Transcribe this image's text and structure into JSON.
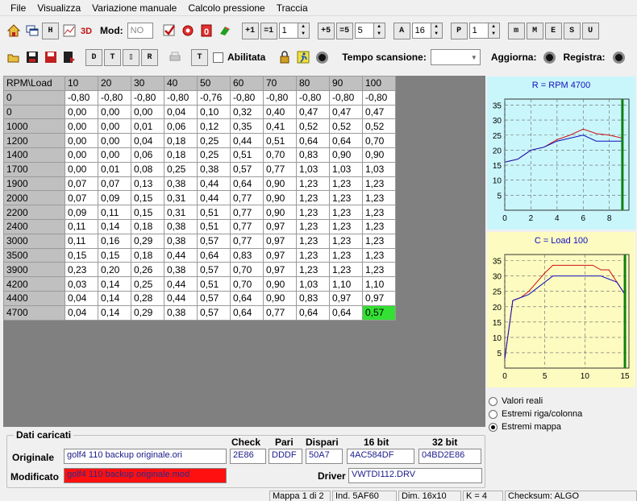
{
  "menu": [
    "File",
    "Visualizza",
    "Variazione manuale",
    "Calcolo pressione",
    "Traccia"
  ],
  "toolbar1": {
    "mod_label": "Mod:",
    "mod_value": "NO",
    "spin1": "1",
    "spin2": "5",
    "spin3": "16",
    "spin4": "1"
  },
  "toolbar2": {
    "abilitata_label": "Abilitata",
    "tempo_label": "Tempo scansione:",
    "aggiorna_label": "Aggiorna:",
    "registra_label": "Registra:"
  },
  "grid": {
    "corner": "RPM\\Load",
    "columns": [
      "10",
      "20",
      "30",
      "40",
      "50",
      "60",
      "70",
      "80",
      "90",
      "100"
    ],
    "rows": [
      {
        "rpm": "0",
        "values": [
          "-0,80",
          "-0,80",
          "-0,80",
          "-0,80",
          "-0,76",
          "-0,80",
          "-0,80",
          "-0,80",
          "-0,80",
          "-0,80"
        ]
      },
      {
        "rpm": "0",
        "values": [
          "0,00",
          "0,00",
          "0,00",
          "0,04",
          "0,10",
          "0,32",
          "0,40",
          "0,47",
          "0,47",
          "0,47"
        ]
      },
      {
        "rpm": "1000",
        "values": [
          "0,00",
          "0,00",
          "0,01",
          "0,06",
          "0,12",
          "0,35",
          "0,41",
          "0,52",
          "0,52",
          "0,52"
        ]
      },
      {
        "rpm": "1200",
        "values": [
          "0,00",
          "0,00",
          "0,04",
          "0,18",
          "0,25",
          "0,44",
          "0,51",
          "0,64",
          "0,64",
          "0,70"
        ]
      },
      {
        "rpm": "1400",
        "values": [
          "0,00",
          "0,00",
          "0,06",
          "0,18",
          "0,25",
          "0,51",
          "0,70",
          "0,83",
          "0,90",
          "0,90"
        ]
      },
      {
        "rpm": "1700",
        "values": [
          "0,00",
          "0,01",
          "0,08",
          "0,25",
          "0,38",
          "0,57",
          "0,77",
          "1,03",
          "1,03",
          "1,03"
        ]
      },
      {
        "rpm": "1900",
        "values": [
          "0,07",
          "0,07",
          "0,13",
          "0,38",
          "0,44",
          "0,64",
          "0,90",
          "1,23",
          "1,23",
          "1,23"
        ]
      },
      {
        "rpm": "2000",
        "values": [
          "0,07",
          "0,09",
          "0,15",
          "0,31",
          "0,44",
          "0,77",
          "0,90",
          "1,23",
          "1,23",
          "1,23"
        ]
      },
      {
        "rpm": "2200",
        "values": [
          "0,09",
          "0,11",
          "0,15",
          "0,31",
          "0,51",
          "0,77",
          "0,90",
          "1,23",
          "1,23",
          "1,23"
        ]
      },
      {
        "rpm": "2400",
        "values": [
          "0,11",
          "0,14",
          "0,18",
          "0,38",
          "0,51",
          "0,77",
          "0,97",
          "1,23",
          "1,23",
          "1,23"
        ]
      },
      {
        "rpm": "3000",
        "values": [
          "0,11",
          "0,16",
          "0,29",
          "0,38",
          "0,57",
          "0,77",
          "0,97",
          "1,23",
          "1,23",
          "1,23"
        ]
      },
      {
        "rpm": "3500",
        "values": [
          "0,15",
          "0,15",
          "0,18",
          "0,44",
          "0,64",
          "0,83",
          "0,97",
          "1,23",
          "1,23",
          "1,23"
        ]
      },
      {
        "rpm": "3900",
        "values": [
          "0,23",
          "0,20",
          "0,26",
          "0,38",
          "0,57",
          "0,70",
          "0,97",
          "1,23",
          "1,23",
          "1,23"
        ]
      },
      {
        "rpm": "4200",
        "values": [
          "0,03",
          "0,14",
          "0,25",
          "0,44",
          "0,51",
          "0,70",
          "0,90",
          "1,03",
          "1,10",
          "1,10"
        ]
      },
      {
        "rpm": "4400",
        "values": [
          "0,04",
          "0,14",
          "0,28",
          "0,44",
          "0,57",
          "0,64",
          "0,90",
          "0,83",
          "0,97",
          "0,97"
        ]
      },
      {
        "rpm": "4700",
        "values": [
          "0,04",
          "0,14",
          "0,29",
          "0,38",
          "0,57",
          "0,64",
          "0,77",
          "0,64",
          "0,64",
          "0,57"
        ]
      }
    ],
    "highlight": {
      "row": 15,
      "col": 9
    },
    "highlight_color": "#33e033"
  },
  "chart_data": [
    {
      "type": "line",
      "title": "R = RPM 4700",
      "x_ticks": [
        0,
        2,
        4,
        6,
        8
      ],
      "xlim": [
        0,
        9.5
      ],
      "y_ticks": [
        5,
        10,
        15,
        20,
        25,
        30,
        35
      ],
      "ylim": [
        0,
        37
      ],
      "series": [
        {
          "color": "#d01010",
          "x": [
            0,
            1,
            2,
            3,
            4,
            5,
            6,
            7,
            8,
            9
          ],
          "y": [
            16,
            17,
            20,
            21,
            23.5,
            25,
            27,
            25.5,
            25,
            24
          ]
        },
        {
          "color": "#1010c0",
          "x": [
            0,
            1,
            2,
            3,
            4,
            5,
            6,
            7,
            8,
            9
          ],
          "y": [
            16,
            17,
            20,
            21,
            23,
            24,
            25,
            23,
            23,
            23
          ]
        }
      ],
      "marker_x": 9,
      "background": "#c9f6fb"
    },
    {
      "type": "line",
      "title": "C = Load 100",
      "x_ticks": [
        0,
        5,
        10,
        15
      ],
      "xlim": [
        0,
        15.5
      ],
      "y_ticks": [
        5,
        10,
        15,
        20,
        25,
        30,
        35
      ],
      "ylim": [
        0,
        37
      ],
      "series": [
        {
          "color": "#d01010",
          "x": [
            0,
            1,
            2,
            3,
            4,
            5,
            6,
            7,
            8,
            9,
            10,
            11,
            12,
            13,
            14,
            15
          ],
          "y": [
            3,
            22,
            23,
            25,
            28,
            31,
            33.5,
            33.5,
            33.5,
            33.5,
            33.5,
            33.5,
            32,
            32,
            28,
            24
          ]
        },
        {
          "color": "#1010c0",
          "x": [
            0,
            1,
            2,
            3,
            4,
            5,
            6,
            7,
            8,
            9,
            10,
            11,
            12,
            13,
            14,
            15
          ],
          "y": [
            3,
            22,
            23,
            24,
            26,
            28,
            30,
            30,
            30,
            30,
            30,
            30,
            30,
            29,
            28,
            24
          ]
        }
      ],
      "marker_x": 15,
      "background": "#fdfbc0"
    }
  ],
  "radio": {
    "options": [
      "Valori reali",
      "Estremi riga/colonna",
      "Estremi mappa"
    ],
    "selected": 2
  },
  "dati": {
    "title": "Dati caricati",
    "originale_label": "Originale",
    "modificato_label": "Modificato",
    "originale_file": "golf4 110 backup originale.ori",
    "modificato_file": "golf4 110 backup originale.mod",
    "check_label": "Check",
    "pari_label": "Pari",
    "dispari_label": "Dispari",
    "bit16_label": "16 bit",
    "bit32_label": "32 bit",
    "check": "2E86",
    "pari": "DDDF",
    "dispari": "50A7",
    "bit16": "4AC584DF",
    "bit32": "04BD2E86",
    "driver_label": "Driver",
    "driver": "VWTDI112.DRV"
  },
  "status": {
    "mappa": "Mappa 1 di 2",
    "ind": "Ind. 5AF60",
    "dim": "Dim. 16x10",
    "k": "K = 4",
    "checksum": "Checksum: ALGO"
  }
}
